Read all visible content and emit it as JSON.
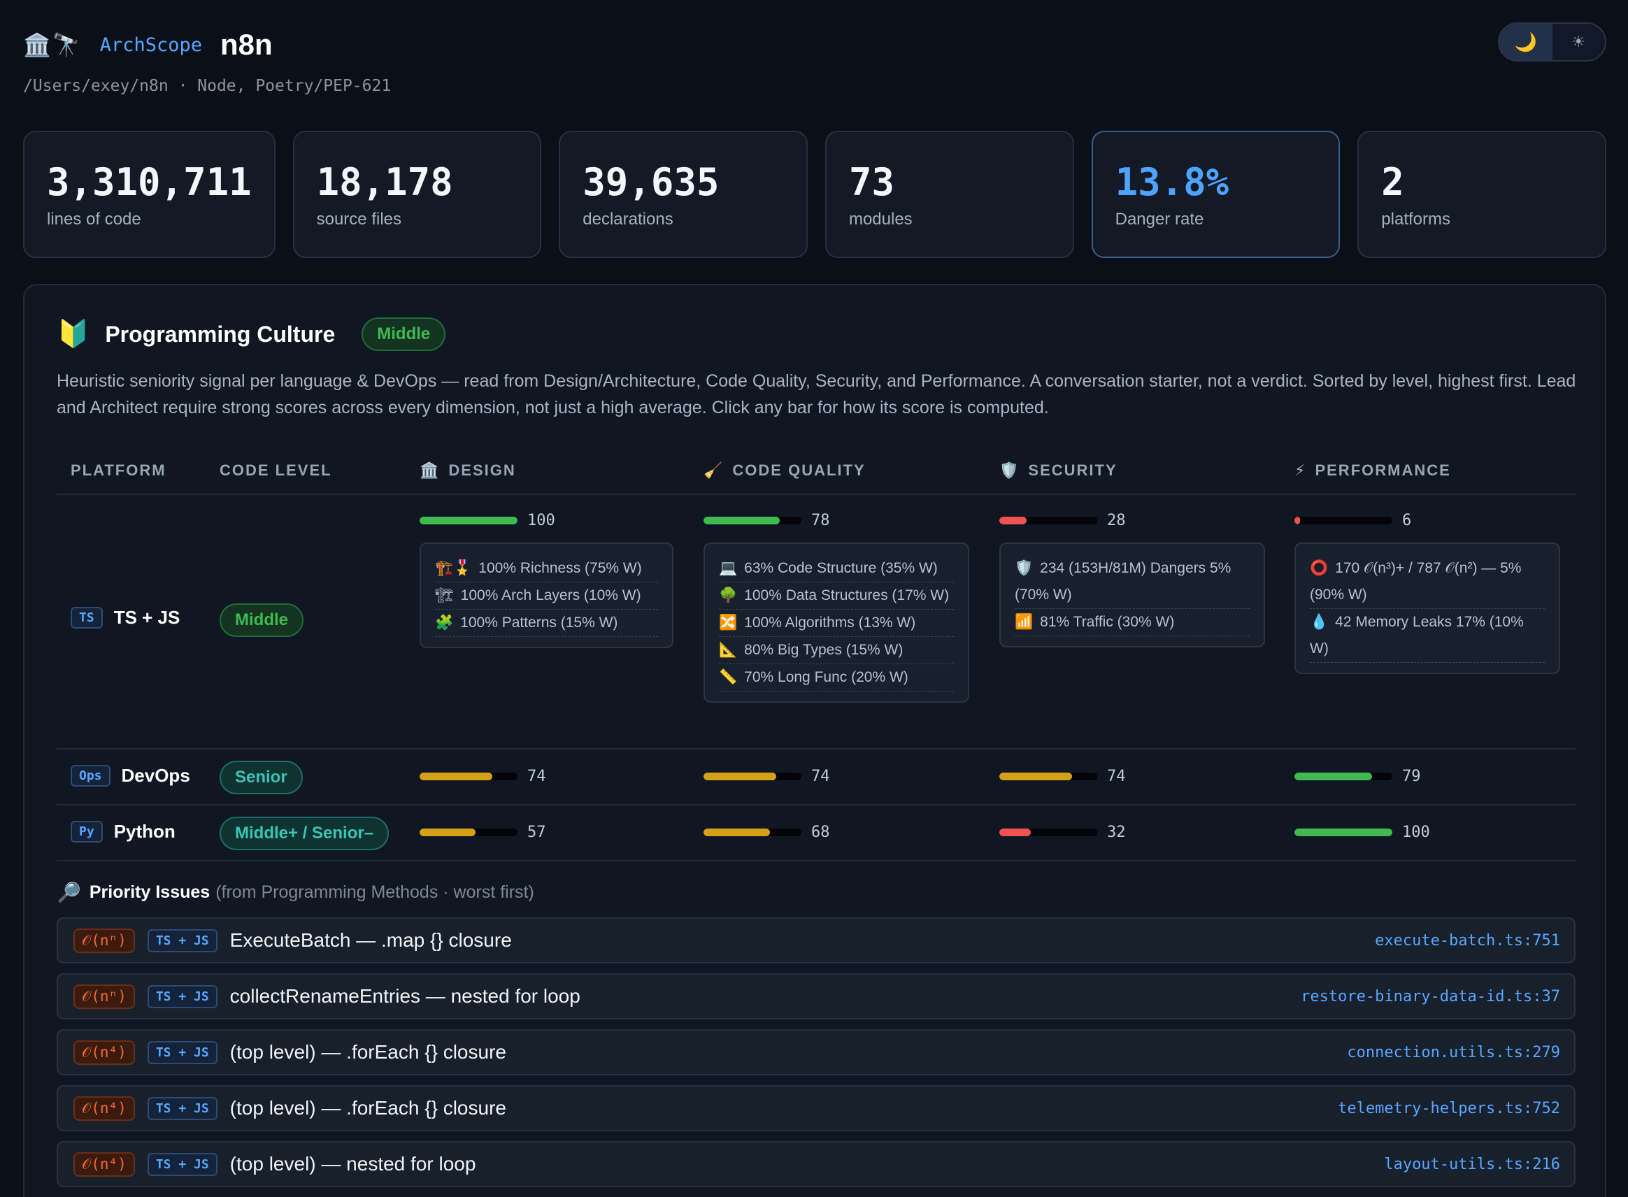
{
  "header": {
    "logo_icons": "🏛️🔭",
    "app_name": "ArchScope",
    "project": "n8n",
    "subpath": "/Users/exey/n8n · Node, Poetry/PEP-621",
    "theme": {
      "dark_icon": "🌙",
      "light_icon": "☀",
      "active": "dark"
    }
  },
  "stats": [
    {
      "value": "3,310,711",
      "label": "lines of code"
    },
    {
      "value": "18,178",
      "label": "source files"
    },
    {
      "value": "39,635",
      "label": "declarations"
    },
    {
      "value": "73",
      "label": "modules"
    },
    {
      "value": "13.8%",
      "label": "Danger rate"
    },
    {
      "value": "2",
      "label": "platforms"
    }
  ],
  "culture": {
    "icon": "🔰",
    "title": "Programming Culture",
    "badge": "Middle",
    "description": "Heuristic seniority signal per language & DevOps — read from Design/Architecture, Code Quality, Security, and Performance. A conversation starter, not a verdict. Sorted by level, highest first. Lead and Architect require strong scores across every dimension, not just a high average. Click any bar for how its score is computed."
  },
  "table": {
    "headers": {
      "platform": "PLATFORM",
      "level": "CODE LEVEL",
      "design": "DESIGN",
      "design_icon": "🏛️",
      "quality": "CODE QUALITY",
      "quality_icon": "🧹",
      "security": "SECURITY",
      "security_icon": "🛡️",
      "performance": "PERFORMANCE",
      "performance_icon": "⚡"
    },
    "rows": [
      {
        "tag": "TS",
        "name": "TS + JS",
        "level": "Middle",
        "design": 100,
        "quality": 78,
        "security": 28,
        "performance": 6,
        "design_details": [
          {
            "icon": "🏗️🎖️",
            "text": "100% Richness (75% W)"
          },
          {
            "icon": "🏗",
            "text": "100% Arch Layers (10% W)"
          },
          {
            "icon": "🧩",
            "text": "100% Patterns (15% W)"
          }
        ],
        "quality_details": [
          {
            "icon": "💻",
            "text": "63% Code Structure (35% W)"
          },
          {
            "icon": "🌳",
            "text": "100% Data Structures (17% W)"
          },
          {
            "icon": "🔀",
            "text": "100% Algorithms (13% W)"
          },
          {
            "icon": "📐",
            "text": "80% Big Types (15% W)"
          },
          {
            "icon": "📏",
            "text": "70% Long Func (20% W)"
          }
        ],
        "security_details": [
          {
            "icon": "🛡️",
            "text": "234 (153H/81M) Dangers 5% (70% W)"
          },
          {
            "icon": "📶",
            "text": "81% Traffic (30% W)"
          }
        ],
        "performance_details": [
          {
            "icon": "⭕",
            "text": "170 𝒪(n³)+ / 787 𝒪(n²) — 5% (90% W)"
          },
          {
            "icon": "💧",
            "text": "42 Memory Leaks 17% (10% W)"
          }
        ]
      },
      {
        "tag": "Ops",
        "name": "DevOps",
        "level": "Senior",
        "design": 74,
        "quality": 74,
        "security": 74,
        "performance": 79
      },
      {
        "tag": "Py",
        "name": "Python",
        "level": "Middle+ / Senior–",
        "design": 57,
        "quality": 68,
        "security": 32,
        "performance": 100
      }
    ]
  },
  "colors": {
    "green": "#3fb950",
    "amber": "#d4a017",
    "red": "#f0524f",
    "accent": "#58a6ff"
  },
  "priority": {
    "icon": "🔎",
    "title": "Priority Issues",
    "subtitle": "(from Programming Methods · worst first)",
    "issues": [
      {
        "complexity": "𝒪(nⁿ)",
        "lang": "TS + JS",
        "text": "ExecuteBatch — .map {} closure",
        "file": "execute-batch.ts:751"
      },
      {
        "complexity": "𝒪(nⁿ)",
        "lang": "TS + JS",
        "text": "collectRenameEntries — nested for loop",
        "file": "restore-binary-data-id.ts:37"
      },
      {
        "complexity": "𝒪(n⁴)",
        "lang": "TS + JS",
        "text": "(top level) — .forEach {} closure",
        "file": "connection.utils.ts:279"
      },
      {
        "complexity": "𝒪(n⁴)",
        "lang": "TS + JS",
        "text": "(top level) — .forEach {} closure",
        "file": "telemetry-helpers.ts:752"
      },
      {
        "complexity": "𝒪(n⁴)",
        "lang": "TS + JS",
        "text": "(top level) — nested for loop",
        "file": "layout-utils.ts:216"
      }
    ]
  }
}
